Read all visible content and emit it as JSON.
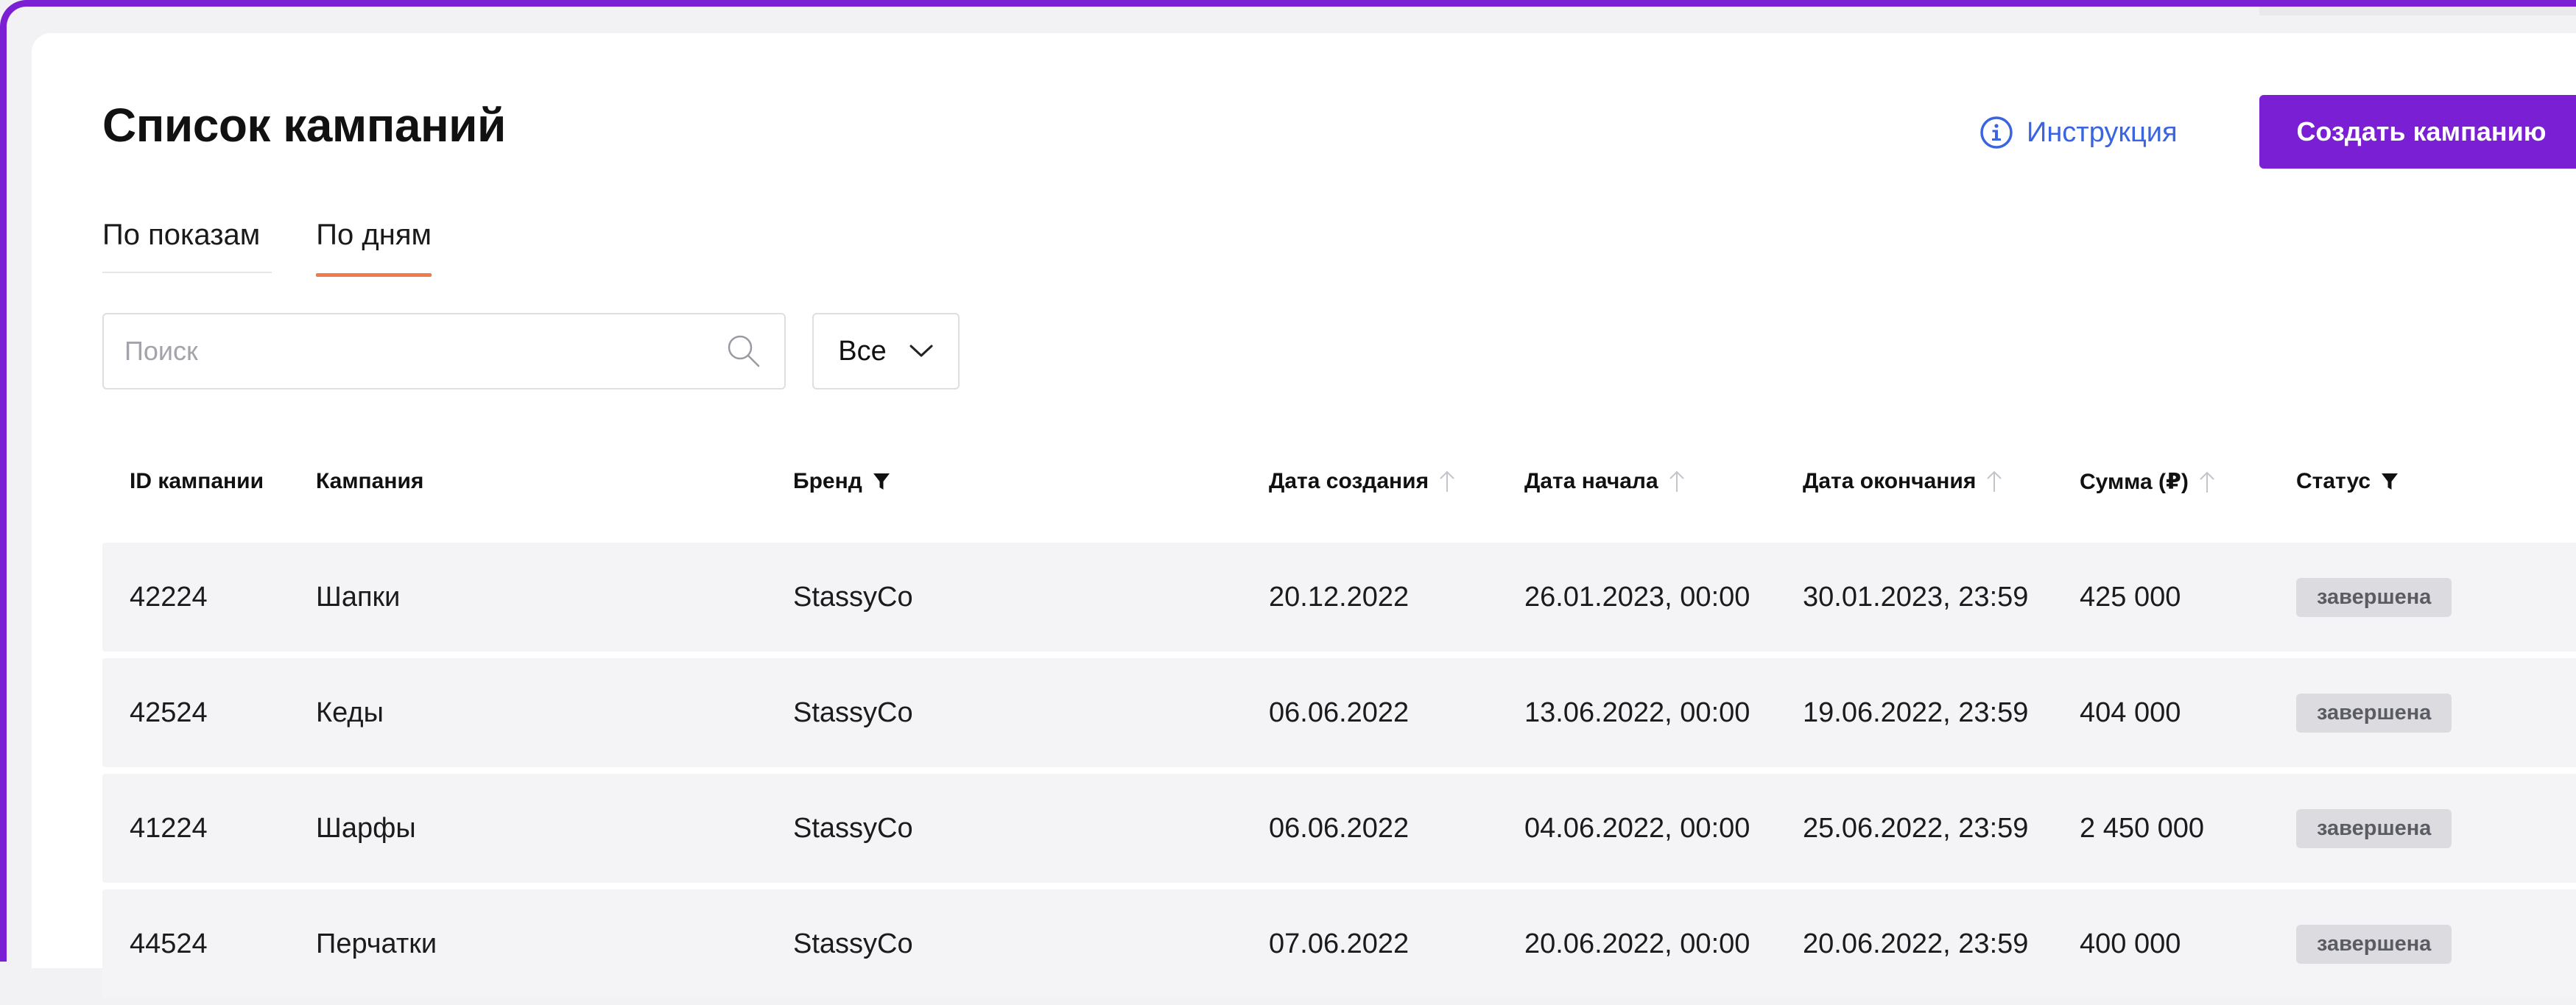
{
  "header": {
    "title": "Список кампаний",
    "instruction_label": "Инструкция",
    "create_button_label": "Создать кампанию"
  },
  "tabs": [
    {
      "label": "По показам",
      "active": false
    },
    {
      "label": "По дням",
      "active": true
    }
  ],
  "search": {
    "placeholder": "Поиск",
    "value": ""
  },
  "filter_select": {
    "value": "Все"
  },
  "table": {
    "columns": [
      {
        "label": "ID кампании",
        "icon": ""
      },
      {
        "label": "Кампания",
        "icon": ""
      },
      {
        "label": "Бренд",
        "icon": "filter-icon"
      },
      {
        "label": "Дата создания",
        "icon": "sort-arrow-up-icon"
      },
      {
        "label": "Дата начала",
        "icon": "sort-arrow-up-icon"
      },
      {
        "label": "Дата окончания",
        "icon": "sort-arrow-up-icon"
      },
      {
        "label": "Сумма (₽)",
        "icon": "sort-arrow-up-icon"
      },
      {
        "label": "Статус",
        "icon": "filter-icon"
      }
    ],
    "rows": [
      [
        "42224",
        "Шапки",
        "StassyCo",
        "20.12.2022",
        "26.01.2023, 00:00",
        "30.01.2023, 23:59",
        "425 000",
        "завершена"
      ],
      [
        "42524",
        "Кеды",
        "StassyCo",
        "06.06.2022",
        "13.06.2022, 00:00",
        "19.06.2022, 23:59",
        "404 000",
        "завершена"
      ],
      [
        "41224",
        "Шарфы",
        "StassyCo",
        "06.06.2022",
        "04.06.2022, 00:00",
        "25.06.2022, 23:59",
        "2 450 000",
        "завершена"
      ],
      [
        "44524",
        "Перчатки",
        "StassyCo",
        "07.06.2022",
        "20.06.2022, 00:00",
        "20.06.2022, 23:59",
        "400 000",
        "завершена"
      ]
    ]
  },
  "colors": {
    "accent": "#7a1fd4",
    "link": "#3a64e0",
    "tab_underline": "#f07a4a",
    "row_bg": "#f4f4f6",
    "badge_bg": "#dcdce0"
  }
}
